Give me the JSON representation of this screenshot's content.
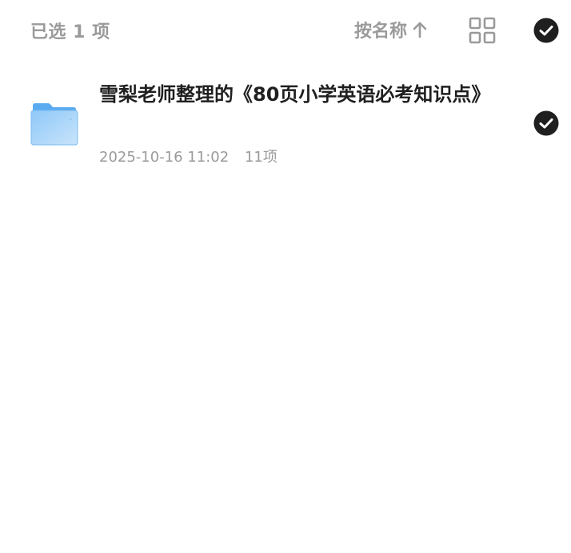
{
  "header": {
    "selected_label": "已选 1 项",
    "sort_label": "按名称",
    "sort_direction_icon": "arrow-up-icon",
    "view_toggle_icon": "grid-view-icon",
    "select_all_icon": "check-circle-filled-icon",
    "select_all_checked": true
  },
  "files": [
    {
      "name": "雪梨老师整理的《80页小学英语必考知识点》",
      "date": "2025-10-16 11:02",
      "count": "11项",
      "icon": "folder-icon",
      "checked": true
    }
  ],
  "colors": {
    "muted_text": "#9a9a9a",
    "primary_text": "#1f1f1f",
    "check_fill": "#1f1f1f",
    "folder_blue": "#5aaaf0",
    "folder_blue_light": "#8ec8f8"
  }
}
